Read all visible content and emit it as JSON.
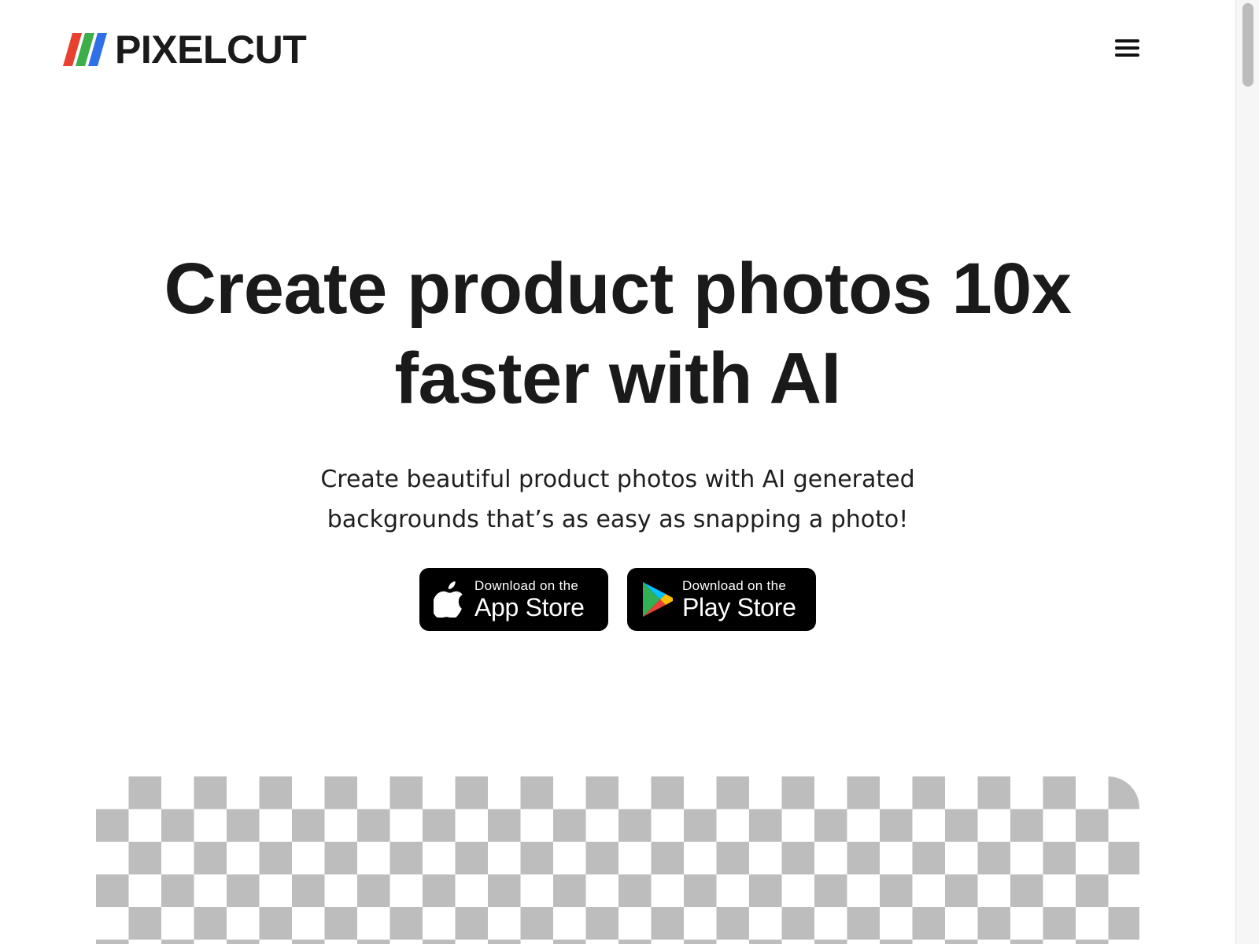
{
  "header": {
    "logo_text": "PIXELCUT",
    "logo_colors": [
      "#e8412f",
      "#3cae4a",
      "#2f6fe8"
    ],
    "menu_icon": "hamburger-menu-icon"
  },
  "hero": {
    "title": "Create product photos 10x faster with AI",
    "subtitle": "Create beautiful product photos with AI generated backgrounds that’s as easy as snapping a photo!"
  },
  "store_buttons": {
    "app_store": {
      "small_label": "Download on the",
      "large_label": "App Store",
      "icon": "apple-icon"
    },
    "play_store": {
      "small_label": "Download on the",
      "large_label": "Play Store",
      "icon": "google-play-icon"
    }
  },
  "colors": {
    "text": "#1a1a1a",
    "button_background": "#000000",
    "checker_gray": "#bdbdbd"
  }
}
